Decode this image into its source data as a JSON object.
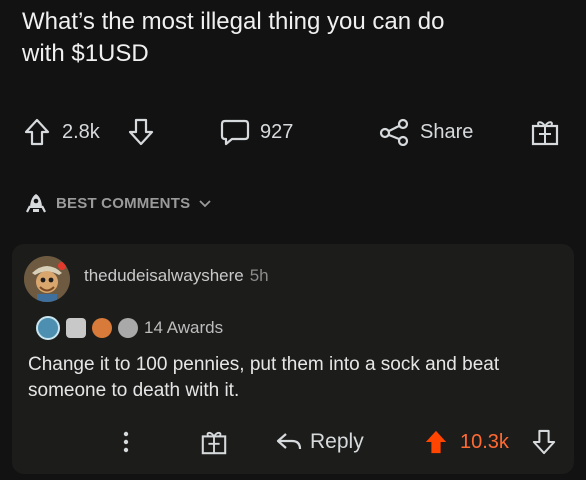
{
  "post": {
    "title": "What’s the most illegal thing you can do\nwith $1USD"
  },
  "actions": {
    "upvotes": "2.8k",
    "comments": "927",
    "share_label": "Share"
  },
  "sort": {
    "label": "BEST COMMENTS"
  },
  "comment": {
    "username": "thedudeisalwayshere",
    "age": "5h",
    "awards_label": "14 Awards",
    "body": "Change it to 100 pennies, put them into a sock and beat someone to death with it.",
    "reply_label": "Reply",
    "score": "10.3k"
  },
  "colors": {
    "background": "#121212",
    "card": "#1c1c1b",
    "upvote_active": "#ff4500"
  }
}
